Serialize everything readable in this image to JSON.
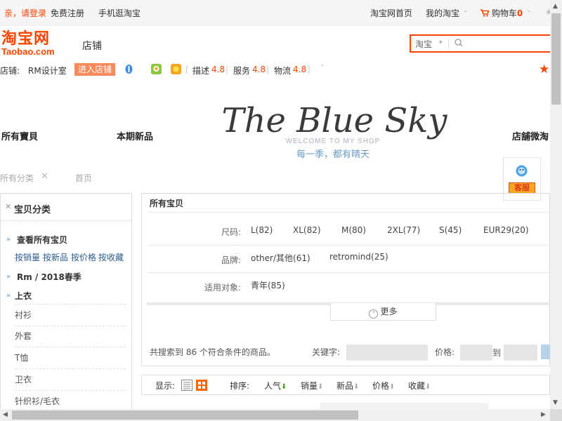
{
  "topbar": {
    "login": "亲，请登录",
    "register": "免费注册",
    "mobile": "手机逛淘宝",
    "home": "淘宝网首页",
    "my_taobao": "我的淘宝",
    "cart": "购物车",
    "cart_count": "0"
  },
  "logo": {
    "cn": "淘宝网",
    "en": "Taobao.com"
  },
  "header": {
    "shop_tab": "店铺"
  },
  "search": {
    "scope": "淘宝",
    "placeholder": ""
  },
  "shopinfo": {
    "label": "店铺:",
    "name": "RM设计室",
    "enter": "进入店铺",
    "desc_label": "描述",
    "desc_score": "4.8",
    "service_label": "服务",
    "service_score": "4.8",
    "logistics_label": "物流",
    "logistics_score": "4.8"
  },
  "banner": {
    "title": "The Blue Sky",
    "welcome": "WELCOME TO MY SHOP",
    "slogan": "每一季，都有晴天"
  },
  "nav": {
    "all_items": "所有寶貝",
    "new_items": "本期新品",
    "weibo": "店舖微淘"
  },
  "breadcrumb": {
    "all_categories": "所有分类",
    "home": "首页"
  },
  "kefu": {
    "label": "客服"
  },
  "sidebar": {
    "title": "宝贝分类",
    "view_all": "查看所有宝贝",
    "sort_links": [
      "按销量",
      "按新品",
      "按价格",
      "按收藏"
    ],
    "season": "Rm / 2018春季",
    "tops": "上衣",
    "sub_items": [
      "衬衫",
      "外套",
      "T恤",
      "卫衣",
      "针织衫/毛衣"
    ]
  },
  "filter": {
    "title": "所有宝贝",
    "size_label": "尺码:",
    "sizes": [
      "L(82)",
      "XL(82)",
      "M(80)",
      "2XL(77)",
      "S(45)",
      "EUR29(20)"
    ],
    "brand_label": "品牌:",
    "brands": [
      "other/其他(61)",
      "retromind(25)"
    ],
    "audience_label": "适用对象:",
    "audiences": [
      "青年(85)"
    ],
    "more": "更多",
    "total": "共搜索到 86 个符合条件的商品。",
    "keyword_label": "关键字:",
    "price_label": "价格:",
    "to_label": "到"
  },
  "sortbar": {
    "display_label": "显示:",
    "sort_label": "排序:",
    "options": [
      "人气",
      "销量",
      "新品",
      "价格",
      "收藏"
    ]
  },
  "colors": {
    "accent": "#ff4400",
    "link": "#2d5d8f"
  }
}
